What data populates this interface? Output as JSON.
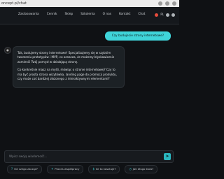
{
  "browser": {
    "url": "oncept.pl/chat"
  },
  "nav": {
    "links": [
      "Zastosowania",
      "Cennik",
      "Sklep",
      "Szkolenia",
      "O nas",
      "Kontakt",
      "Chat"
    ],
    "badge": "PL"
  },
  "chat": {
    "user_message": "Czy budujecie strony internetowe?",
    "ai_paragraph_1": "Tak, budujemy strony internetowe! Specjalizujemy się w szybkim tworzeniu prototypów i MVP, co oznacza, że możemy błyskawicznie zamienić Twój pomysł w działającą stronę.",
    "ai_paragraph_2": "Co konkretnie masz na myśli, mówiąc o stronie internetowej? Czy to ma być prosta strona wizytówka, landing page do promocji produktu, czy może coś bardziej złożonego z interaktywnymi elementami?"
  },
  "composer": {
    "placeholder": "Wpisz swoją wiadomość..."
  },
  "chips": [
    {
      "label": "Od czego zacząć?",
      "icon": "question-icon"
    },
    {
      "label": "Proces współpracy",
      "icon": "handshake-icon"
    },
    {
      "label": "Ile to kosztuje?",
      "icon": "coin-icon"
    },
    {
      "label": "Jak długo trwa?",
      "icon": "clock-icon"
    }
  ],
  "colors": {
    "accent": "#3fd4d9",
    "background": "#0f1114"
  }
}
